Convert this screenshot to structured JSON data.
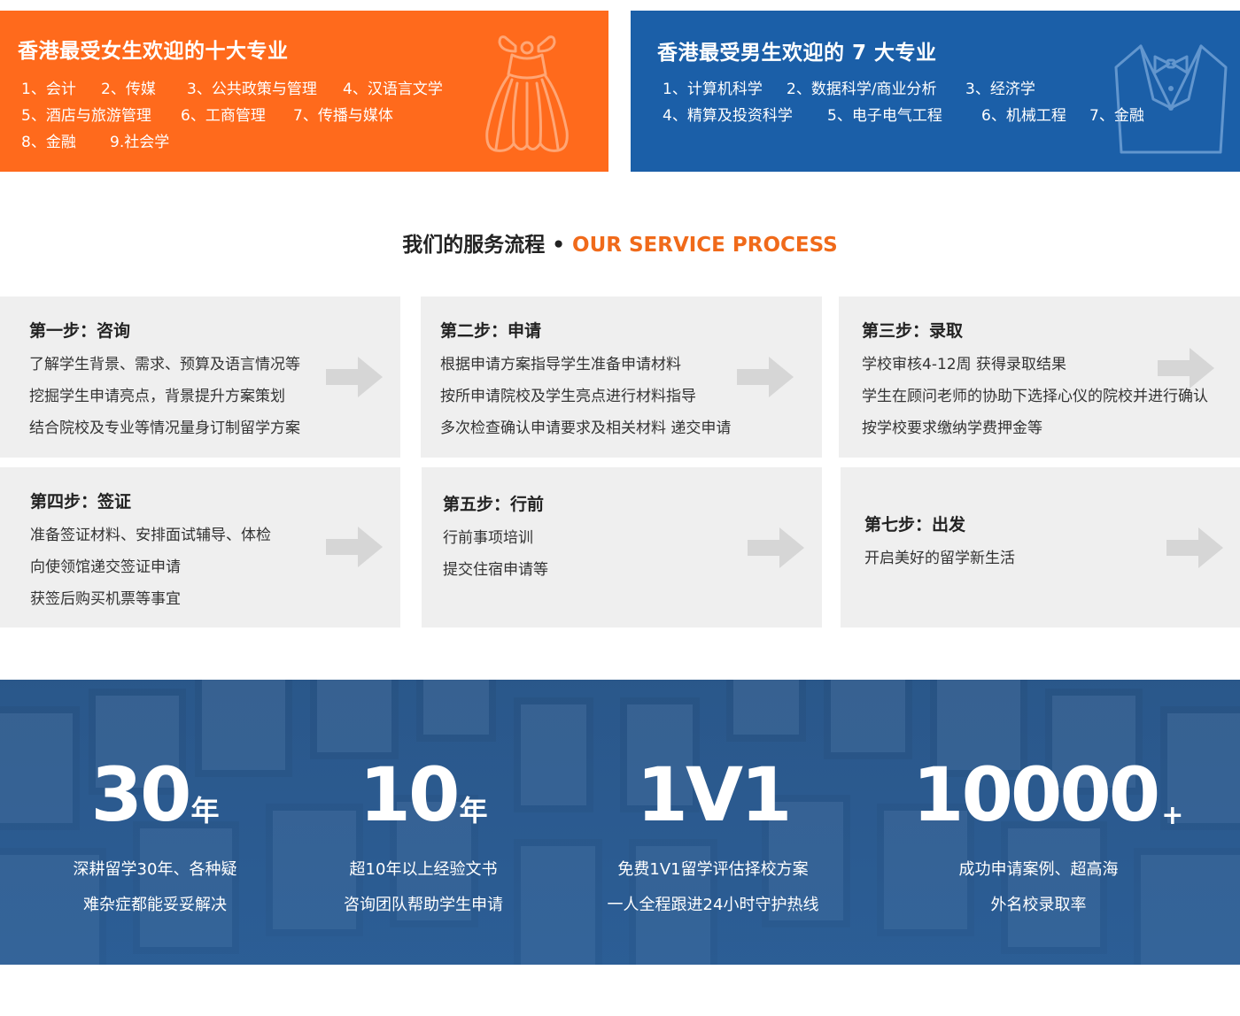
{
  "banners": {
    "girls": {
      "title": "香港最受女生欢迎的十大专业",
      "rows": [
        [
          "1、会计",
          "2、传媒",
          "3、公共政策与管理",
          "4、汉语言文学"
        ],
        [
          "5、酒店与旅游管理",
          "6、工商管理",
          "7、传播与媒体"
        ],
        [
          "8、金融",
          "9.社会学"
        ]
      ],
      "icon": "dress-icon",
      "color": "#ff6a1c"
    },
    "boys": {
      "title": "香港最受男生欢迎的 7 大专业",
      "rows": [
        [
          "1、计算机科学",
          "2、数据科学/商业分析",
          "3、经济学"
        ],
        [
          "4、精算及投资科学",
          "5、电子电气工程",
          "6、机械工程",
          "7、金融"
        ]
      ],
      "icon": "tuxedo-icon",
      "color": "#1b5fa8"
    }
  },
  "process": {
    "title_cn": "我们的服务流程",
    "dot": "•",
    "title_en": "OUR SERVICE PROCESS",
    "accent": "#f06a1a",
    "steps": [
      {
        "title": "第一步：咨询",
        "lines": [
          "了解学生背景、需求、预算及语言情况等",
          "挖掘学生申请亮点，背景提升方案策划",
          "结合院校及专业等情况量身订制留学方案"
        ]
      },
      {
        "title": "第二步：申请",
        "lines": [
          "根据申请方案指导学生准备申请材料",
          "按所申请院校及学生亮点进行材料指导",
          "多次检查确认申请要求及相关材料 递交申请"
        ]
      },
      {
        "title": "第三步：录取",
        "lines": [
          "学校审核4-12周   获得录取结果",
          "学生在顾问老师的协助下选择心仪的院校并进行确认",
          "按学校要求缴纳学费押金等"
        ]
      },
      {
        "title": "第四步：签证",
        "lines": [
          "准备签证材料、安排面试辅导、体检",
          "向使领馆递交签证申请",
          "获签后购买机票等事宜"
        ]
      },
      {
        "title": "第五步：行前",
        "lines": [
          "行前事项培训",
          "提交住宿申请等"
        ]
      },
      {
        "title": "第七步：出发",
        "lines": [
          "开启美好的留学新生活"
        ]
      }
    ]
  },
  "stats": [
    {
      "value": "30",
      "unit": "年",
      "desc": [
        "深耕留学30年、各种疑",
        "难杂症都能妥妥解决"
      ]
    },
    {
      "value": "10",
      "unit": "年",
      "desc": [
        "超10年以上经验文书",
        "咨询团队帮助学生申请"
      ]
    },
    {
      "value": "1V1",
      "unit": "",
      "desc": [
        "免费1V1留学评估择校方案",
        "一人全程跟进24小时守护热线"
      ]
    },
    {
      "value": "10000",
      "unit": "+",
      "desc": [
        "成功申请案例、超高海",
        "外名校录取率"
      ]
    }
  ]
}
